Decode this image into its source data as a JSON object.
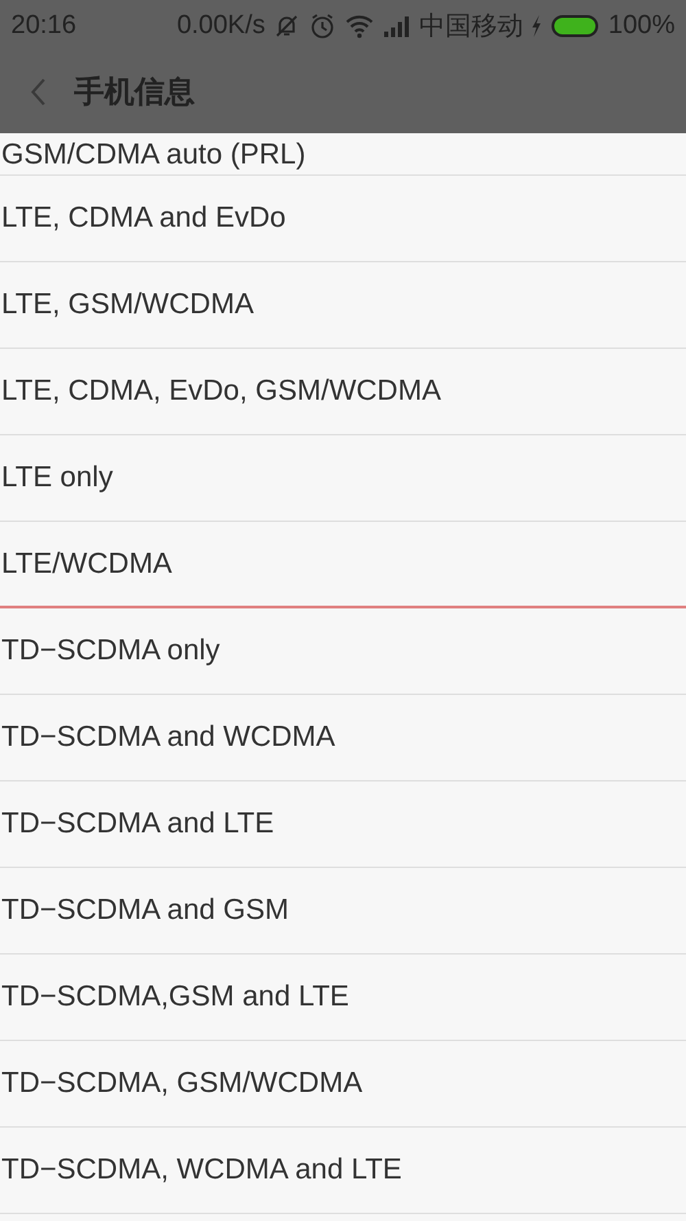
{
  "status_bar": {
    "time": "20:16",
    "speed": "0.00K/s",
    "carrier": "中国移动",
    "battery": "100%"
  },
  "header": {
    "title": "手机信息"
  },
  "options": [
    {
      "label": "GSM/CDMA auto (PRL)",
      "marked": false
    },
    {
      "label": "LTE, CDMA and EvDo",
      "marked": false
    },
    {
      "label": "LTE, GSM/WCDMA",
      "marked": false
    },
    {
      "label": "LTE, CDMA, EvDo, GSM/WCDMA",
      "marked": false
    },
    {
      "label": "LTE only",
      "marked": false
    },
    {
      "label": "LTE/WCDMA",
      "marked": true
    },
    {
      "label": "TD−SCDMA only",
      "marked": false
    },
    {
      "label": "TD−SCDMA and WCDMA",
      "marked": false
    },
    {
      "label": "TD−SCDMA and LTE",
      "marked": false
    },
    {
      "label": "TD−SCDMA and GSM",
      "marked": false
    },
    {
      "label": "TD−SCDMA,GSM and LTE",
      "marked": false
    },
    {
      "label": "TD−SCDMA, GSM/WCDMA",
      "marked": false
    },
    {
      "label": "TD−SCDMA, WCDMA and LTE",
      "marked": false
    }
  ]
}
